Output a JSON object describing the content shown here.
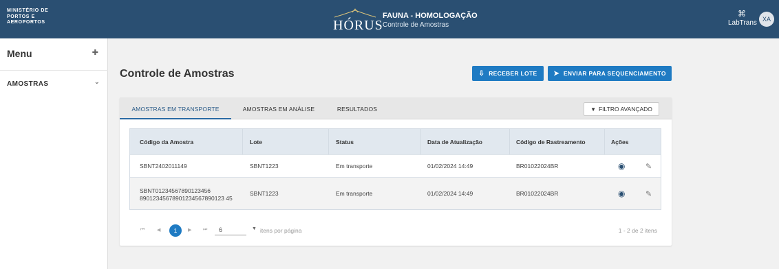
{
  "header": {
    "org_lines": [
      "MINISTÉRIO DE",
      "PORTOS E",
      "AEROPORTOS"
    ],
    "logo_text": "HÓRUS",
    "app_title": "FAUNA - HOMOLOGAÇÃO",
    "app_subtitle": "Controle de Amostras",
    "labtrans_label": "LabTrans",
    "avatar_initials": "XA",
    "bg_color": "#2a4f72"
  },
  "sidebar": {
    "title": "Menu",
    "items": [
      {
        "label": "AMOSTRAS",
        "icon": "chevron-down-icon"
      }
    ]
  },
  "main": {
    "page_title": "Controle de Amostras",
    "actions": {
      "receber_label": "RECEBER LOTE",
      "enviar_label": "ENVIAR PARA SEQUENCIAMENTO",
      "accent_color": "#1f7bc3"
    },
    "tabs": [
      {
        "label": "AMOSTRAS EM TRANSPORTE",
        "active": true
      },
      {
        "label": "AMOSTRAS EM ANÁLISE",
        "active": false
      },
      {
        "label": "RESULTADOS",
        "active": false
      }
    ],
    "filter_label": "FILTRO AVANÇADO",
    "table": {
      "columns": [
        "Código da Amostra",
        "Lote",
        "Status",
        "Data de Atualização",
        "Código de Rastreamento",
        "Ações"
      ],
      "rows": [
        {
          "codigo": "SBNT2402011149",
          "lote": "SBNT1223",
          "status": "Em transporte",
          "data": "01/02/2024 14:49",
          "rastreamento": "BR01022024BR"
        },
        {
          "codigo": "SBNT01234567890123456 89012345678901234567890123 45",
          "lote": "SBNT1223",
          "status": "Em transporte",
          "data": "01/02/2024 14:49",
          "rastreamento": "BR01022024BR"
        }
      ]
    },
    "pagination": {
      "current_page": "1",
      "page_size": "6",
      "per_page_label": "itens por página",
      "info": "1 - 2 de 2 itens"
    }
  }
}
